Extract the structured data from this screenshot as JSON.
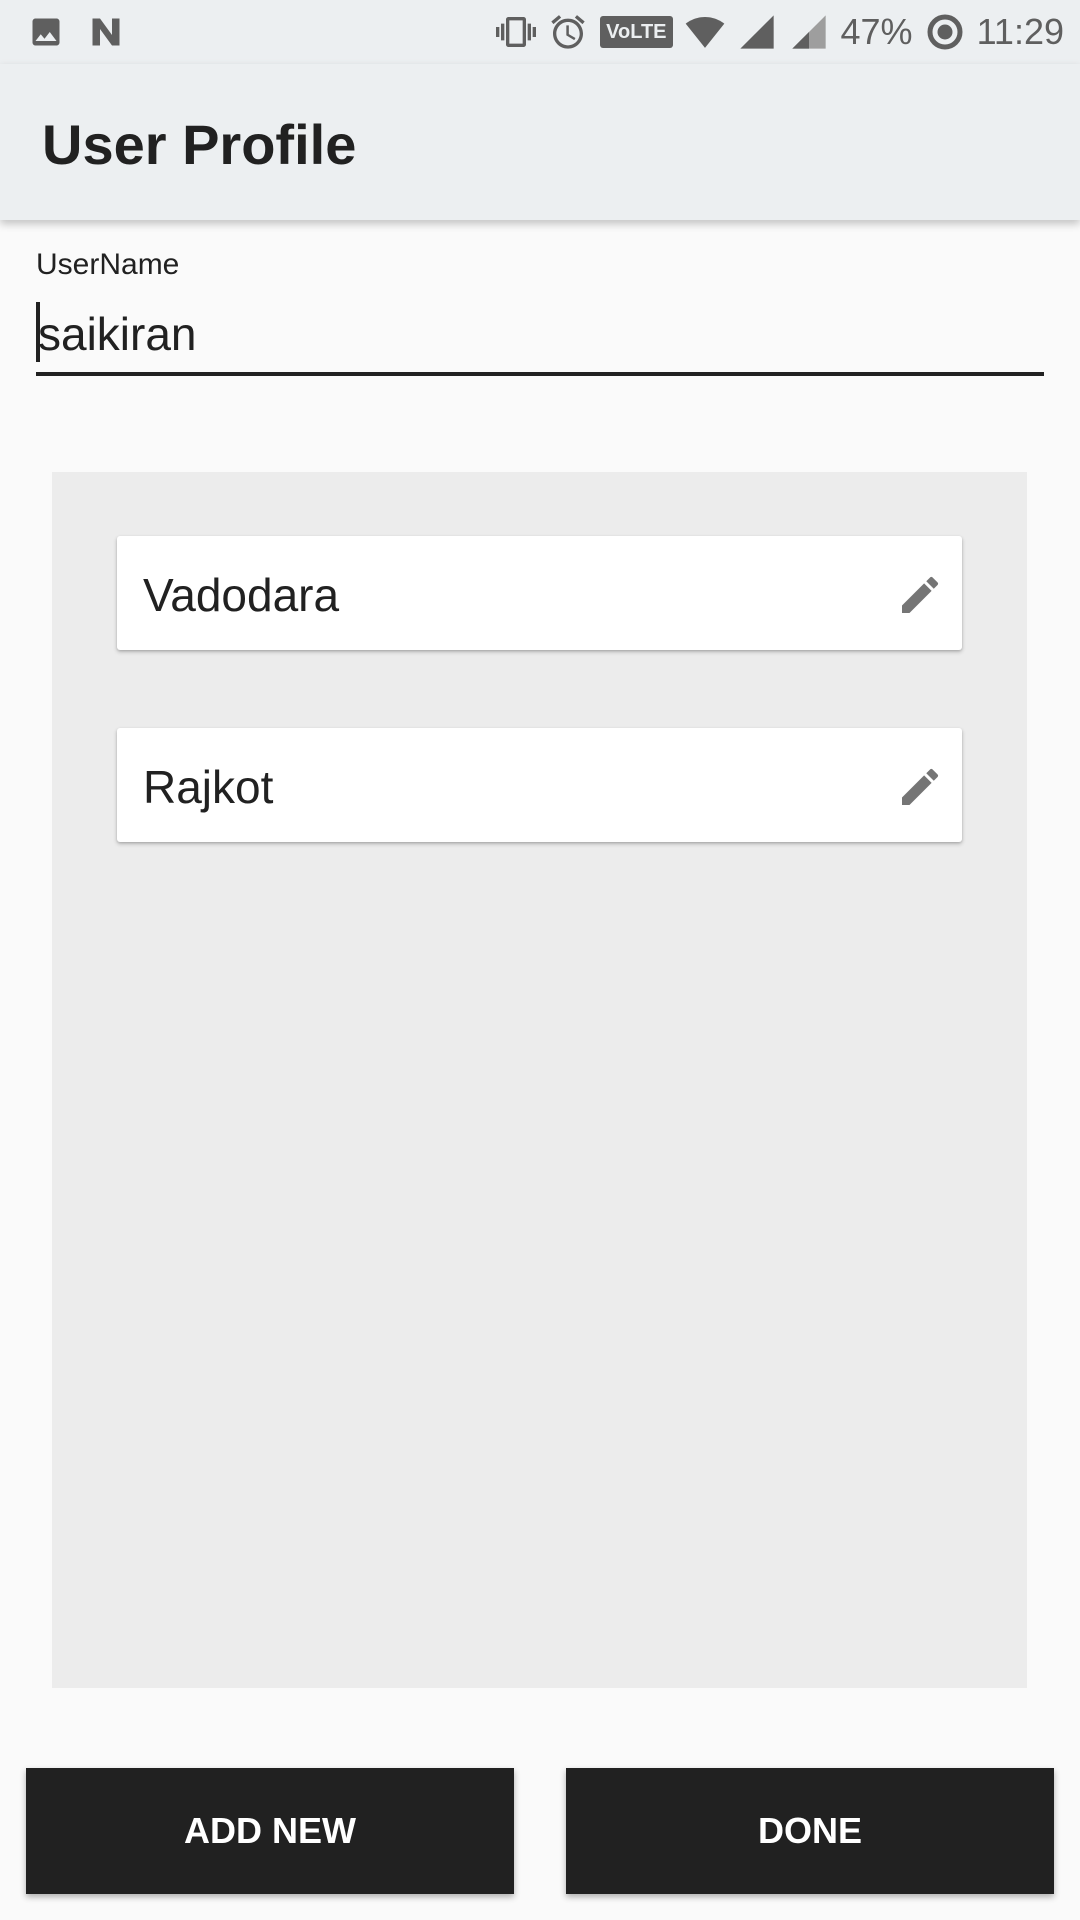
{
  "status_bar": {
    "left_icons": [
      "image-icon",
      "n-icon"
    ],
    "right_icons": [
      "vibrate-icon",
      "alarm-icon",
      "volte-icon",
      "wifi-icon",
      "signal-icon",
      "signal-weak-icon",
      "battery-saver-icon"
    ],
    "volte_label": "VoLTE",
    "battery": "47%",
    "time": "11:29"
  },
  "app_bar": {
    "title": "User Profile"
  },
  "username": {
    "label": "UserName",
    "value": "saikiran"
  },
  "cities": [
    {
      "name": "Vadodara",
      "edit_icon": "pencil-icon"
    },
    {
      "name": "Rajkot",
      "edit_icon": "pencil-icon"
    }
  ],
  "buttons": {
    "add_new": "ADD NEW",
    "done": "DONE"
  },
  "colors": {
    "bar_background": "#eceff1",
    "page_background": "#fafafa",
    "panel_background": "#ececec",
    "button_background": "#212121",
    "text_primary": "#212121",
    "icon_grey": "#757575"
  }
}
